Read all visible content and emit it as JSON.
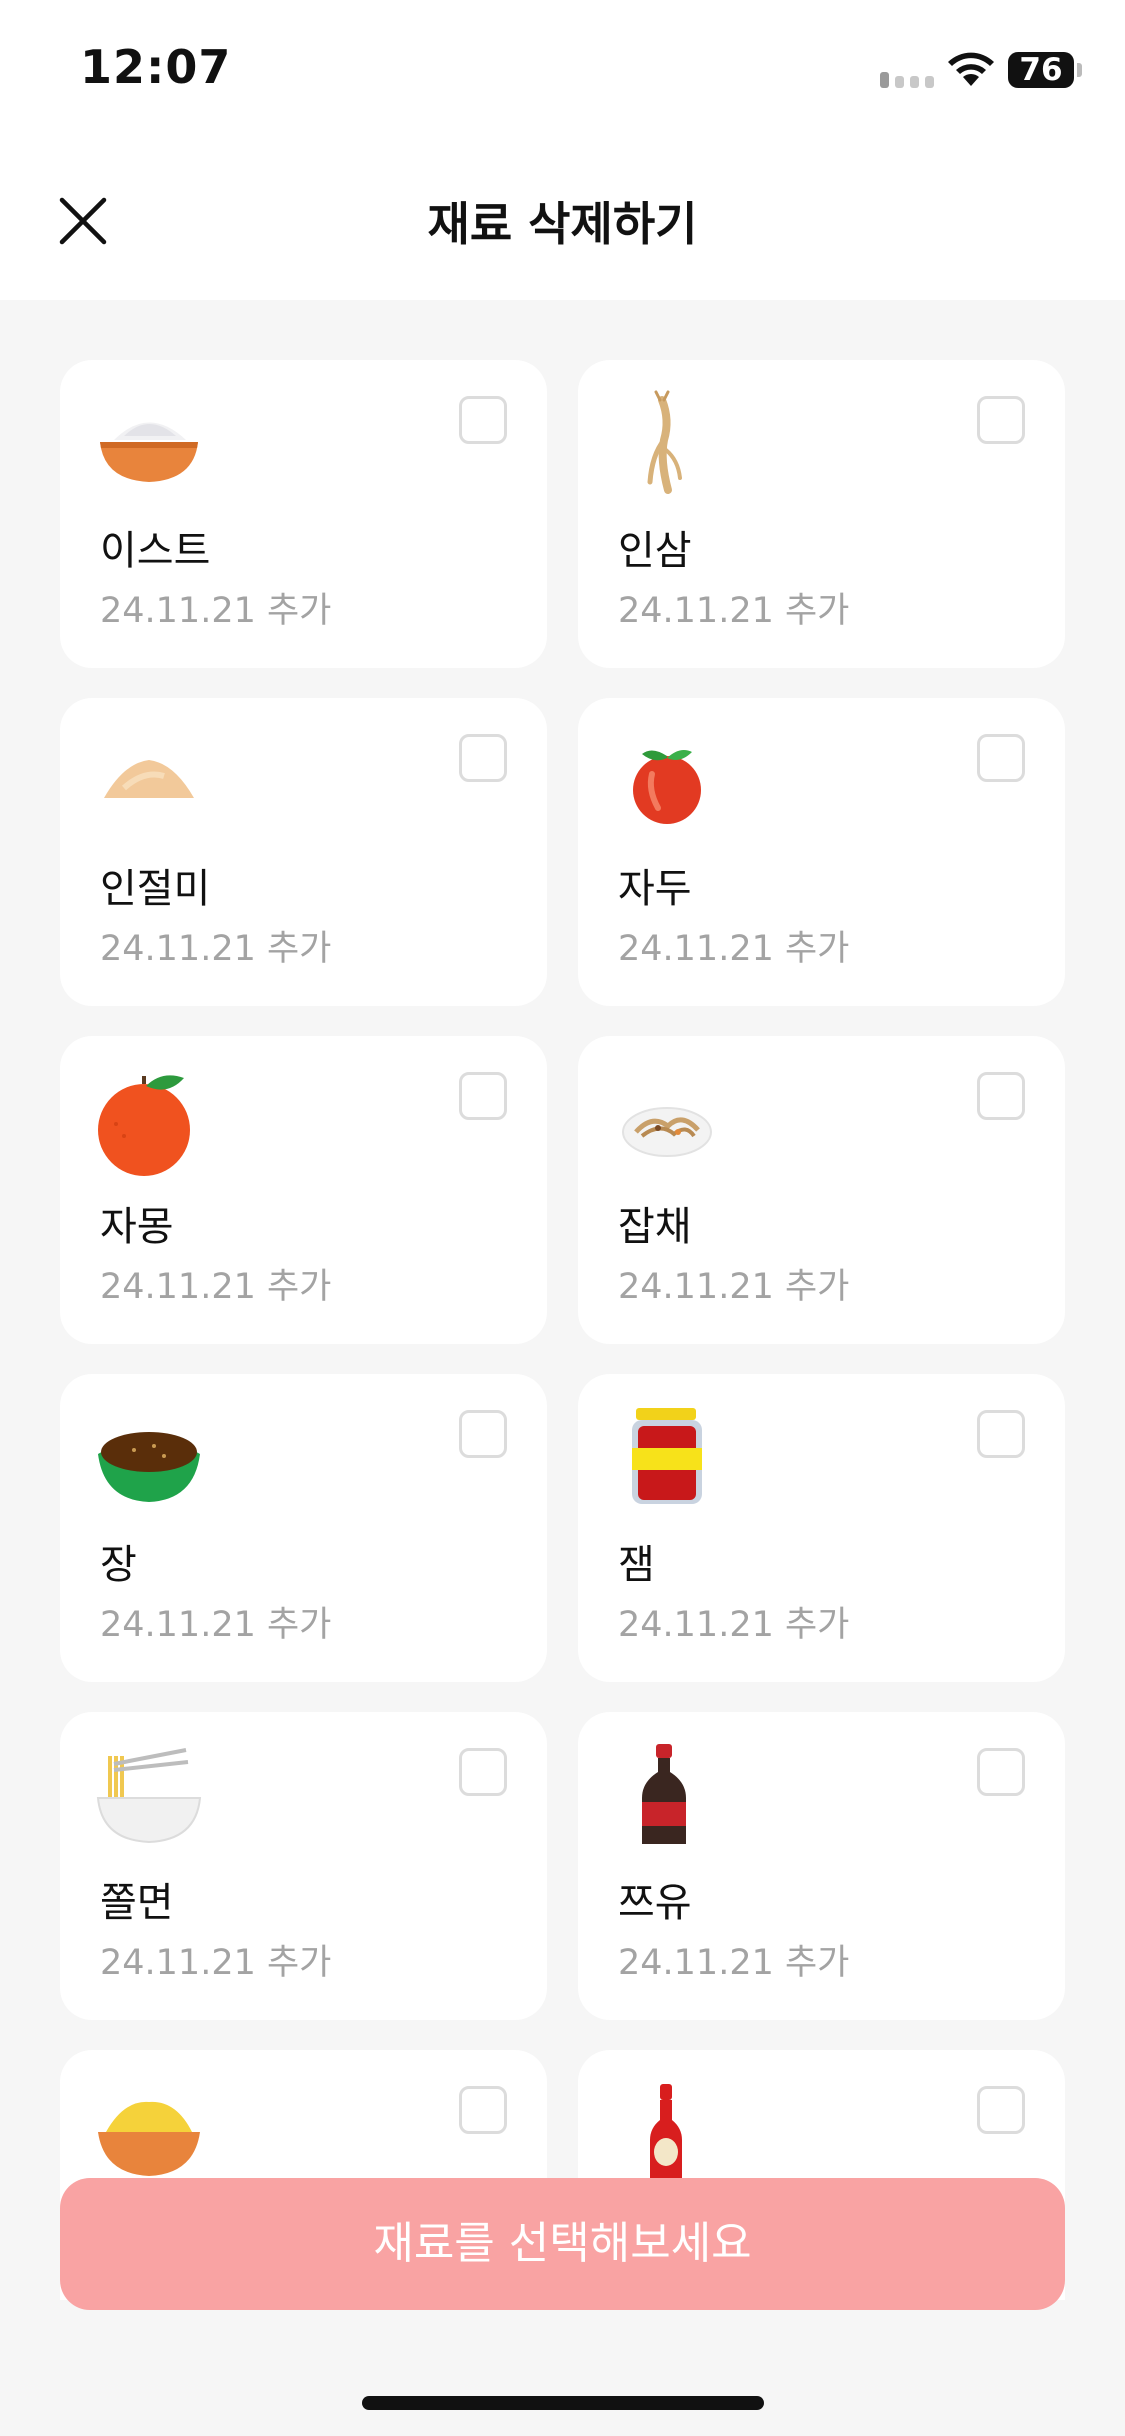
{
  "status_bar": {
    "time": "12:07",
    "battery": "76"
  },
  "header": {
    "title": "재료 삭제하기"
  },
  "ingredients": [
    {
      "name": "이스트",
      "date": "24.11.21  추가",
      "icon": "flour-bowl-icon"
    },
    {
      "name": "인삼",
      "date": "24.11.21  추가",
      "icon": "ginseng-icon"
    },
    {
      "name": "인절미",
      "date": "24.11.21  추가",
      "icon": "powder-pile-icon"
    },
    {
      "name": "자두",
      "date": "24.11.21  추가",
      "icon": "plum-icon"
    },
    {
      "name": "자몽",
      "date": "24.11.21  추가",
      "icon": "grapefruit-icon"
    },
    {
      "name": "잡채",
      "date": "24.11.21  추가",
      "icon": "noodle-plate-icon"
    },
    {
      "name": "장",
      "date": "24.11.21  추가",
      "icon": "sauce-bowl-icon"
    },
    {
      "name": "잼",
      "date": "24.11.21  추가",
      "icon": "jam-jar-icon"
    },
    {
      "name": "쫄면",
      "date": "24.11.21  추가",
      "icon": "noodle-bowl-icon"
    },
    {
      "name": "쯔유",
      "date": "24.11.21  추가",
      "icon": "soy-bottle-icon"
    },
    {
      "name": "",
      "date": "",
      "icon": "yellow-bowl-icon"
    },
    {
      "name": "",
      "date": "",
      "icon": "hot-sauce-icon"
    }
  ],
  "cta": {
    "label": "재료를 선택해보세요"
  }
}
